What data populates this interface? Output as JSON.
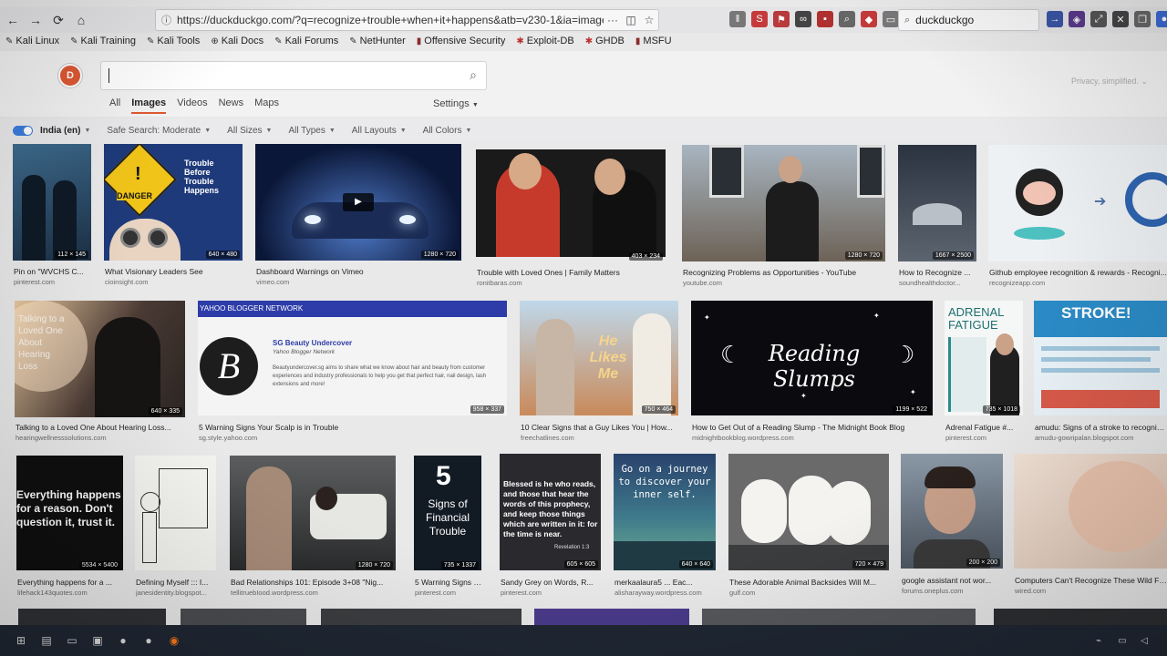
{
  "browser": {
    "url": "https://duckduckgo.com/?q=recognize+trouble+when+it+happens&atb=v230-1&ia=images",
    "search_value": "duckduckgo"
  },
  "bookmarks": [
    {
      "label": "Kali Linux"
    },
    {
      "label": "Kali Training"
    },
    {
      "label": "Kali Tools"
    },
    {
      "label": "Kali Docs"
    },
    {
      "label": "Kali Forums"
    },
    {
      "label": "NetHunter"
    },
    {
      "label": "Offensive Security"
    },
    {
      "label": "Exploit-DB"
    },
    {
      "label": "GHDB"
    },
    {
      "label": "MSFU"
    }
  ],
  "ddg": {
    "search_value": "",
    "tabs": [
      "All",
      "Images",
      "Videos",
      "News",
      "Maps"
    ],
    "active_tab": "Images",
    "settings_label": "Settings",
    "privacy_label": "Privacy, simplified.",
    "accent": "#de5833"
  },
  "filters": {
    "region": "India (en)",
    "safe_search": "Safe Search: Moderate",
    "sizes": "All Sizes",
    "types": "All Types",
    "layouts": "All Layouts",
    "colors": "All Colors"
  },
  "row1": [
    {
      "title": "Pin on \"WVCHS C...",
      "source": "pinterest.com",
      "dims": "112 × 145"
    },
    {
      "title": "What Visionary Leaders See",
      "source": "cioinsight.com",
      "dims": "640 × 480",
      "overlay_title": "Trouble Before Trouble Happens",
      "sign": "DANGER"
    },
    {
      "title": "Dashboard Warnings on Vimeo",
      "source": "vimeo.com",
      "dims": "1280 × 720"
    },
    {
      "title": "Trouble with Loved Ones | Family Matters",
      "source": "ronitbaras.com",
      "dims": "403 × 234"
    },
    {
      "title": "Recognizing Problems as Opportunities - YouTube",
      "source": "youtube.com",
      "dims": "1280 × 720"
    },
    {
      "title": "How to Recognize ...",
      "source": "soundhealthdoctor...",
      "dims": "1667 × 2500"
    },
    {
      "title": "Github employee recognition & rewards - Recogni...",
      "source": "recognizeapp.com",
      "dims": ""
    }
  ],
  "row2": [
    {
      "title": "Talking to a Loved One About Hearing Loss...",
      "source": "hearingwellnesssolutions.com",
      "dims": "640 × 335",
      "overlay_title": "Talking to a Loved One About Hearing Loss"
    },
    {
      "title": "5 Warning Signs Your Scalp is in Trouble",
      "source": "sg.style.yahoo.com",
      "dims": "958 × 337",
      "network": "YAHOO BLOGGER NETWORK",
      "blog": "SG Beauty Undercover",
      "blog_sub": "Yahoo Blogger Network",
      "blog_desc": "Beautyundercover.sg aims to share what we know about hair and beauty from customer experiences and industry professionals to help you get that perfect hair, nail design, lash extensions and more!"
    },
    {
      "title": "10 Clear Signs that a Guy Likes You | How...",
      "source": "freechatlines.com",
      "dims": "750 × 464",
      "overlay_title": "He Likes Me"
    },
    {
      "title": "How to Get Out of a Reading Slump - The Midnight Book Blog",
      "source": "midnightbookblog.wordpress.com",
      "dims": "1199 × 522",
      "overlay_title": "Reading Slumps"
    },
    {
      "title": "Adrenal Fatigue #...",
      "source": "pinterest.com",
      "dims": "735 × 1018",
      "overlay_title": "ADRENAL FATIGUE"
    },
    {
      "title": "amudu: Signs of a stroke to recognize...",
      "source": "amudu-gowripalan.blogspot.com",
      "dims": "",
      "overlay_title": "STROKE!"
    }
  ],
  "row3": [
    {
      "title": "Everything happens for a ...",
      "source": "lifehack143quotes.com",
      "dims": "5534 × 5400",
      "overlay_title": "Everything happens for a reason. Don't question it, trust it."
    },
    {
      "title": "Defining Myself ::: I...",
      "source": "janesidentity.blogspot...",
      "dims": ""
    },
    {
      "title": "Bad Relationships 101: Episode 3+08 \"Nig...",
      "source": "tellitruebIood.wordpress.com",
      "dims": "1280 × 720"
    },
    {
      "title": "5 Warning Signs of...",
      "source": "pinterest.com",
      "dims": "735 × 1337",
      "overlay_num": "5",
      "overlay_title": "Signs of Financial Trouble"
    },
    {
      "title": "Sandy Grey on Words, R...",
      "source": "pinterest.com",
      "dims": "605 × 605",
      "overlay_title": "Blessed is he who reads, and those that hear the words of this prophecy, and keep those things which are written in it: for the time is near.",
      "overlay_ref": "Revelation 1:3"
    },
    {
      "title": "merkaalaura5 ... Eac...",
      "source": "alisharayway.wordpress.com",
      "dims": "640 × 640",
      "overlay_title": "Go on a journey to discover your inner self."
    },
    {
      "title": "These Adorable Animal Backsides Will M...",
      "source": "gulf.com",
      "dims": "720 × 479"
    },
    {
      "title": "google assistant not wor...",
      "source": "forums.oneplus.com",
      "dims": "200 × 200"
    },
    {
      "title": "Computers Can't Recognize These Wild Fa...",
      "source": "wired.com",
      "dims": ""
    }
  ]
}
